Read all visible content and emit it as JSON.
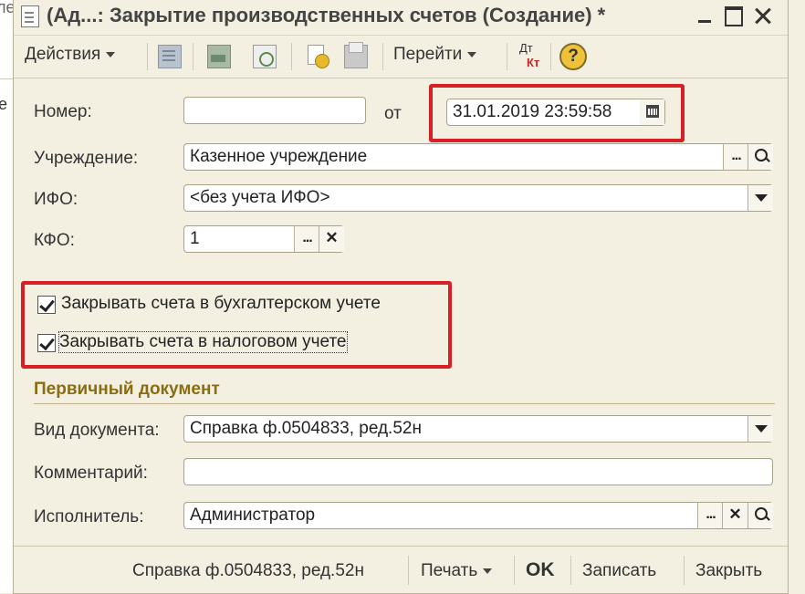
{
  "window": {
    "title": "(Ад...: Закрытие производственных счетов (Создание) *"
  },
  "left_edge": {
    "glyph_top": "ле",
    "glyph_mid": "е"
  },
  "toolbar": {
    "actions_label": "Действия",
    "goto_label": "Перейти",
    "dt_label": "Дт",
    "kt_label": "Кт",
    "help_label": "?"
  },
  "form": {
    "number_label": "Номер:",
    "number_value": "",
    "from_label": "от",
    "date_value": "31.01.2019 23:59:58",
    "institution_label": "Учреждение:",
    "institution_value": "Казенное учреждение",
    "ifo_label": "ИФО:",
    "ifo_value": "<без учета ИФО>",
    "kfo_label": "КФО:",
    "kfo_value": "1",
    "checkbox_accounting_label": "Закрывать счета в бухгалтерском учете",
    "checkbox_accounting_checked": true,
    "checkbox_tax_label": "Закрывать счета в налоговом учете",
    "checkbox_tax_checked": true
  },
  "primary_document": {
    "section_title": "Первичный документ",
    "doc_type_label": "Вид документа:",
    "doc_type_value": "Справка ф.0504833, ред.52н",
    "comment_label": "Комментарий:",
    "comment_value": "",
    "executor_label": "Исполнитель:",
    "executor_value": "Администратор"
  },
  "footer": {
    "doc_link": "Справка ф.0504833, ред.52н",
    "print_label": "Печать",
    "ok_label": "OK",
    "save_label": "Записать",
    "close_label": "Закрыть"
  },
  "highlight_color": "#d81f26"
}
